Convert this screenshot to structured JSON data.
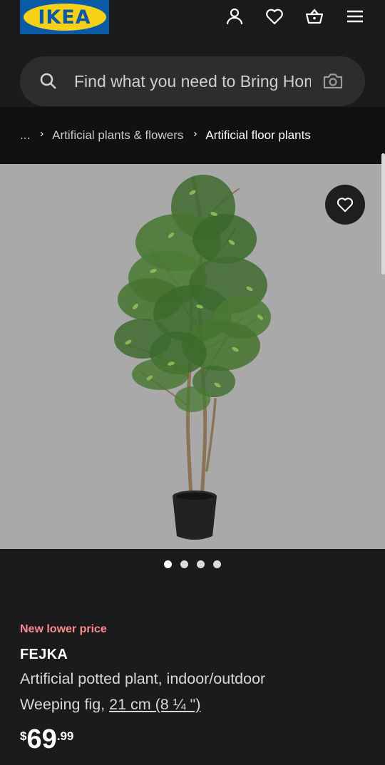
{
  "header": {
    "logo_text": "IKEA",
    "icons": [
      "account-icon",
      "heart-icon",
      "basket-icon",
      "menu-icon"
    ]
  },
  "search": {
    "placeholder": "Find what you need to Bring Home"
  },
  "breadcrumb": {
    "ellipsis": "...",
    "items": [
      "Artificial plants & flowers",
      "Artificial floor plants"
    ]
  },
  "gallery": {
    "image_count": 4,
    "active_index": 0
  },
  "product": {
    "badge": "New lower price",
    "name": "FEJKA",
    "description": "Artificial potted plant, indoor/outdoor",
    "variant_prefix": "Weeping fig, ",
    "size": "21 cm (8 ¼ \")",
    "price": {
      "currency": "$",
      "integer": "69",
      "decimal": ".99"
    }
  },
  "colors": {
    "background": "#1b1b1c",
    "breadcrumb_bg": "#111112",
    "accent_red": "#ff8a8f",
    "ikea_blue": "#0a5aa5",
    "ikea_yellow": "#f7d117"
  }
}
